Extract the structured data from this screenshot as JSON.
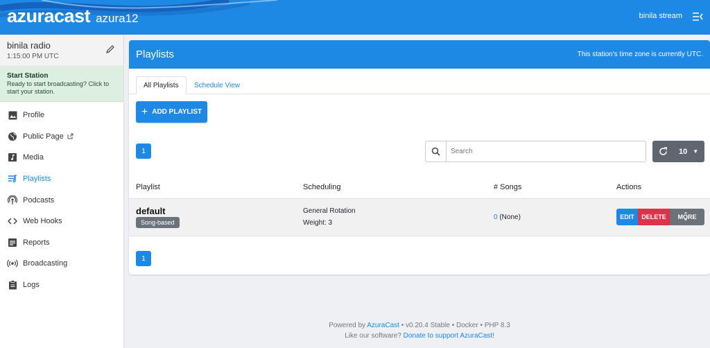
{
  "header": {
    "logo": "azuracast",
    "station_short": "azura12",
    "user": "binila stream"
  },
  "sidebar": {
    "station_name": "binila radio",
    "station_time": "1:15:00 PM UTC",
    "start_title": "Start Station",
    "start_desc": "Ready to start broadcasting? Click to start your station.",
    "items": [
      {
        "label": "Profile",
        "icon": "image-icon"
      },
      {
        "label": "Public Page",
        "icon": "globe-icon"
      },
      {
        "label": "Media",
        "icon": "music-library-icon"
      },
      {
        "label": "Playlists",
        "icon": "playlist-icon"
      },
      {
        "label": "Podcasts",
        "icon": "podcast-icon"
      },
      {
        "label": "Web Hooks",
        "icon": "code-icon"
      },
      {
        "label": "Reports",
        "icon": "report-icon"
      },
      {
        "label": "Broadcasting",
        "icon": "broadcast-icon"
      },
      {
        "label": "Logs",
        "icon": "clipboard-icon"
      }
    ],
    "active_item": "Playlists"
  },
  "main": {
    "title": "Playlists",
    "timezone_note": "This station's time zone is currently UTC.",
    "tabs": [
      {
        "label": "All Playlists",
        "active": true
      },
      {
        "label": "Schedule View",
        "active": false
      }
    ],
    "add_button": "ADD PLAYLIST",
    "page_number": "1",
    "search_placeholder": "Search",
    "per_page": "10",
    "columns": [
      "Playlist",
      "Scheduling",
      "# Songs",
      "Actions"
    ],
    "rows": [
      {
        "name": "default",
        "badge": "Song-based",
        "scheduling": "General Rotation",
        "weight": "Weight: 3",
        "song_count": "0",
        "song_note": "(None)",
        "actions": [
          "EDIT",
          "DELETE",
          "MORE"
        ]
      }
    ]
  },
  "footer": {
    "powered_prefix": "Powered by",
    "powered_link": "AzuraCast",
    "version": "• v0.20.4 Stable • Docker • PHP 8.3",
    "like_text": "Like our software?",
    "donate_link": "Donate to support AzuraCast!"
  },
  "colors": {
    "primary": "#1e88e5",
    "danger": "#e0314b",
    "secondary": "#6b727a",
    "start_bg": "#dcefe0"
  }
}
